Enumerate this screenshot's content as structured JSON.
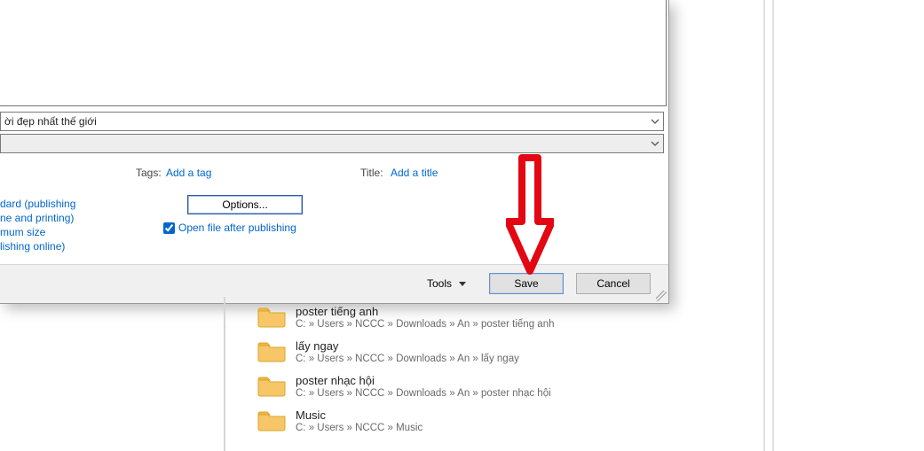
{
  "dialog": {
    "filename_value": "ời đẹp nhất thế giới",
    "filetype_value": "",
    "tags_label": "Tags:",
    "tags_link": "Add a tag",
    "title_label": "Title:",
    "title_link": "Add a title",
    "left_options": {
      "line1": "dard (publishing",
      "line2": "ne and printing)",
      "line3": "mum size",
      "line4": "lishing online)"
    },
    "options_button": "Options...",
    "open_after_label": "Open file after publishing",
    "open_after_checked": true,
    "tools_label": "Tools",
    "save_label": "Save",
    "cancel_label": "Cancel"
  },
  "behind": {
    "items": [
      {
        "name": "poster tiếng anh",
        "path": "C: » Users » NCCC » Downloads » An » poster tiếng anh",
        "cut_top": true
      },
      {
        "name": "lấy ngay",
        "path": "C: » Users » NCCC » Downloads » An » lấy ngay"
      },
      {
        "name": "poster nhạc hội",
        "path": "C: » Users » NCCC » Downloads » An » poster nhạc hội"
      },
      {
        "name": "Music",
        "path": "C: » Users » NCCC » Music"
      }
    ]
  }
}
